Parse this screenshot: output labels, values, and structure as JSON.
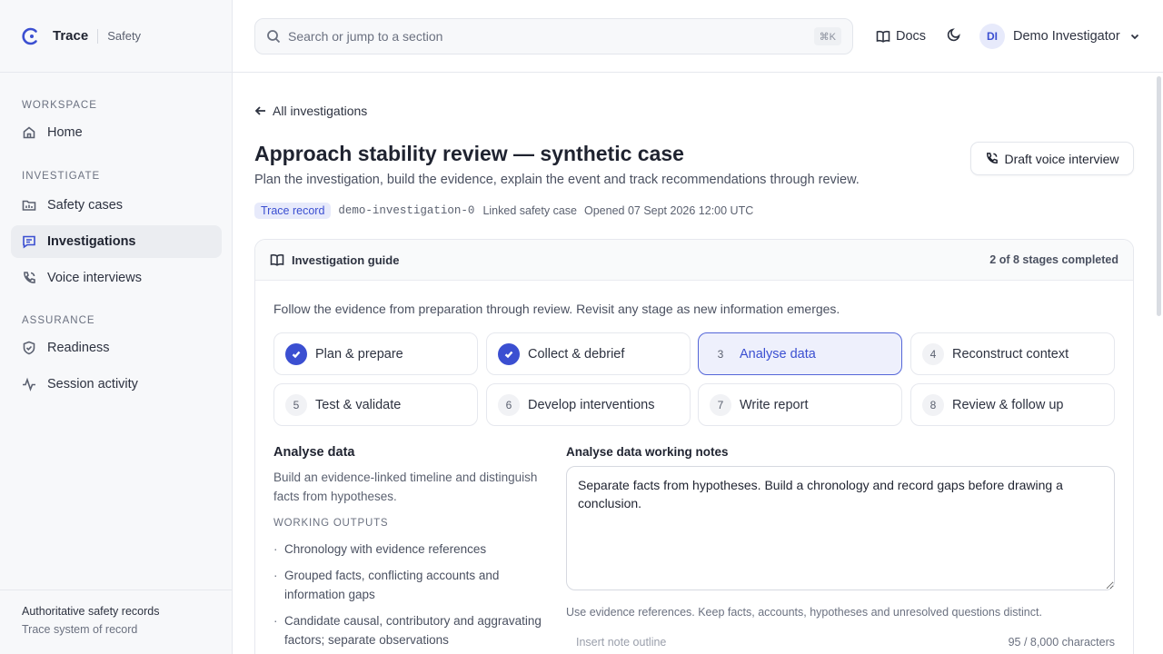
{
  "brand": {
    "name": "Trace",
    "sub": "Safety"
  },
  "sidebar": {
    "sections": [
      {
        "heading": "WORKSPACE",
        "items": [
          {
            "label": "Home",
            "icon": "home-icon"
          }
        ]
      },
      {
        "heading": "INVESTIGATE",
        "items": [
          {
            "label": "Safety cases",
            "icon": "folder-chart-icon"
          },
          {
            "label": "Investigations",
            "icon": "message-icon",
            "active": true
          },
          {
            "label": "Voice interviews",
            "icon": "phone-icon"
          }
        ]
      },
      {
        "heading": "ASSURANCE",
        "items": [
          {
            "label": "Readiness",
            "icon": "shield-check-icon"
          },
          {
            "label": "Session activity",
            "icon": "activity-icon"
          }
        ]
      }
    ],
    "footer": {
      "title": "Authoritative safety records",
      "sub": "Trace system of record"
    }
  },
  "topbar": {
    "search_placeholder": "Search or jump to a section",
    "search_shortcut": "⌘K",
    "docs_label": "Docs",
    "user_initials": "DI",
    "user_name": "Demo Investigator"
  },
  "page": {
    "back_label": "All investigations",
    "title": "Approach stability review — synthetic case",
    "subtitle": "Plan the investigation, build the evidence, explain the event and track recommendations through review.",
    "badge": "Trace record",
    "record_id": "demo-investigation-0",
    "linked": "Linked safety case",
    "opened": "Opened 07 Sept 2026 12:00 UTC",
    "voice_button": "Draft voice interview"
  },
  "guide": {
    "title": "Investigation guide",
    "progress": "2 of 8 stages completed",
    "intro": "Follow the evidence from preparation through review. Revisit any stage as new information emerges.",
    "stages": [
      {
        "num": "1",
        "label": "Plan & prepare",
        "done": true
      },
      {
        "num": "2",
        "label": "Collect & debrief",
        "done": true
      },
      {
        "num": "3",
        "label": "Analyse data",
        "active": true
      },
      {
        "num": "4",
        "label": "Reconstruct context"
      },
      {
        "num": "5",
        "label": "Test & validate"
      },
      {
        "num": "6",
        "label": "Develop interventions"
      },
      {
        "num": "7",
        "label": "Write report"
      },
      {
        "num": "8",
        "label": "Review & follow up"
      }
    ],
    "detail": {
      "title": "Analyse data",
      "desc": "Build an evidence-linked timeline and distinguish facts from hypotheses.",
      "outputs_heading": "WORKING OUTPUTS",
      "outputs": [
        "Chronology with evidence references",
        "Grouped facts, conflicting accounts and information gaps",
        "Candidate causal, contributory and aggravating factors; separate observations"
      ]
    },
    "notes": {
      "label": "Analyse data working notes",
      "value": "Separate facts from hypotheses. Build a chronology and record gaps before drawing a conclusion.",
      "hint": "Use evidence references. Keep facts, accounts, hypotheses and unresolved questions distinct.",
      "insert_outline": "Insert note outline",
      "char_count": "95 / 8,000 characters"
    }
  }
}
